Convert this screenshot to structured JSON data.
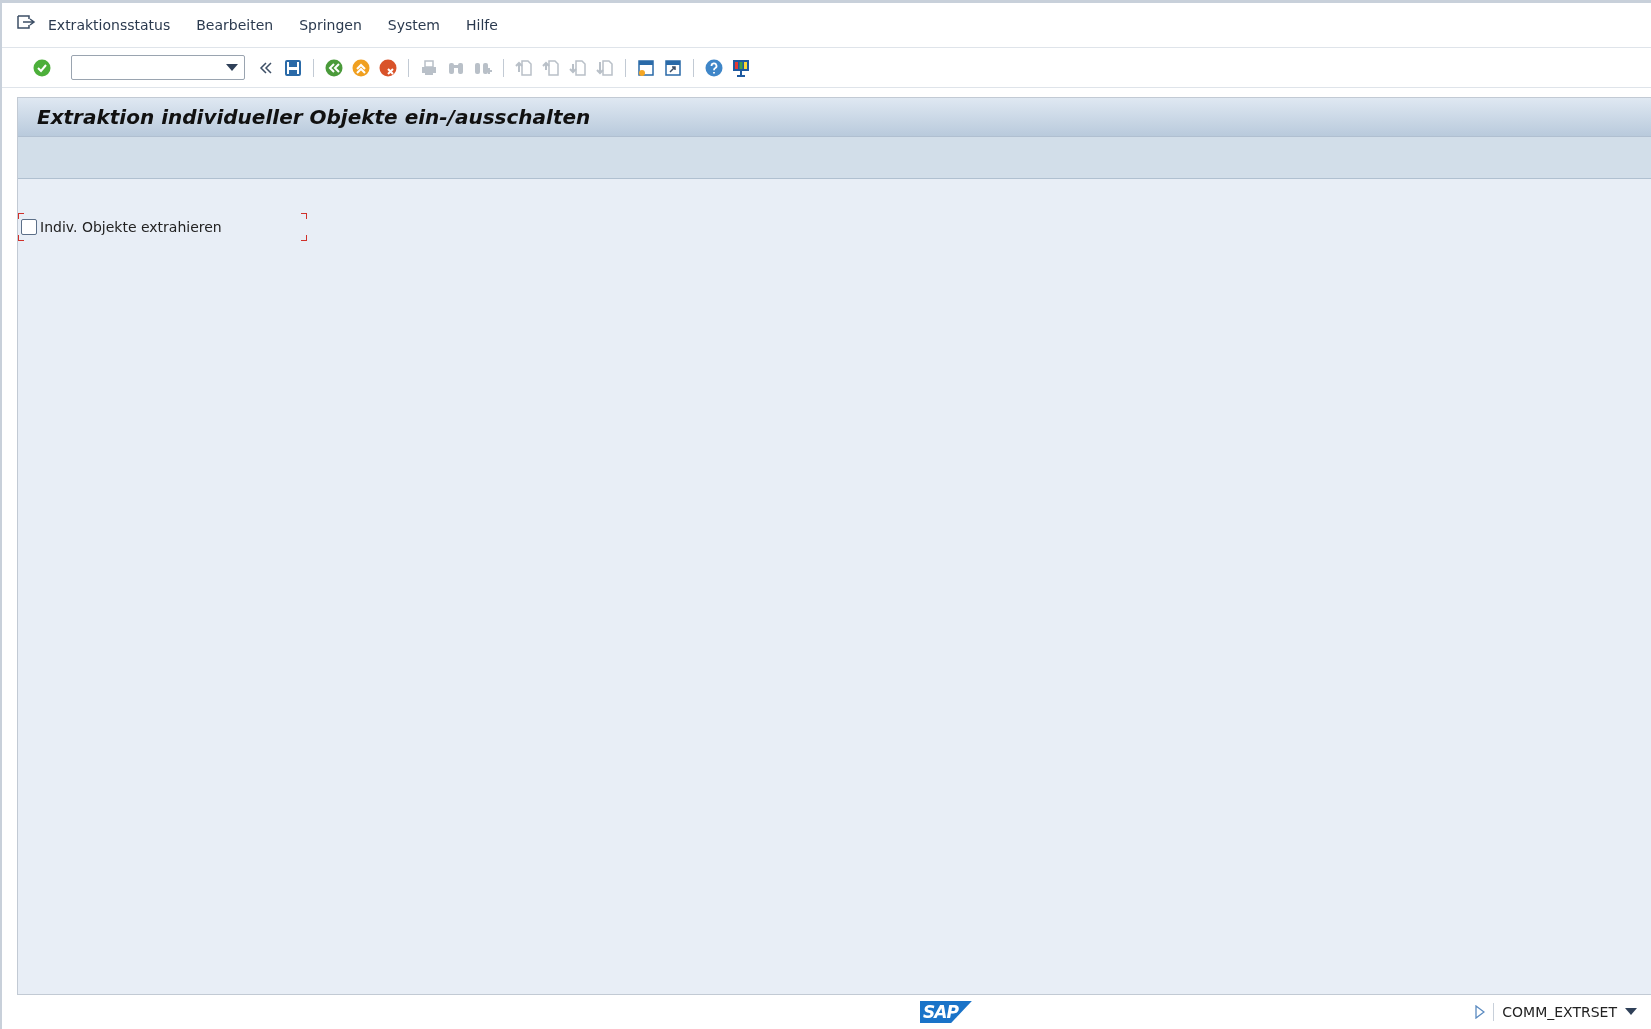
{
  "menu_bar": {
    "items": [
      {
        "label": "Extraktionsstatus"
      },
      {
        "label": "Bearbeiten"
      },
      {
        "label": "Springen"
      },
      {
        "label": "System"
      },
      {
        "label": "Hilfe"
      }
    ]
  },
  "toolbar": {
    "groups": [
      [
        {
          "kind": "enter",
          "disabled": false
        },
        {
          "kind": "command-field",
          "disabled": false
        },
        {
          "kind": "collapse",
          "disabled": false
        },
        {
          "kind": "save",
          "disabled": false
        }
      ],
      [
        {
          "kind": "back",
          "disabled": false
        },
        {
          "kind": "exit",
          "disabled": false
        },
        {
          "kind": "cancel",
          "disabled": false
        }
      ],
      [
        {
          "kind": "print",
          "disabled": true
        },
        {
          "kind": "find",
          "disabled": true
        },
        {
          "kind": "find-next",
          "disabled": true
        }
      ],
      [
        {
          "kind": "first-page",
          "disabled": true
        },
        {
          "kind": "previous-page",
          "disabled": true
        },
        {
          "kind": "next-page",
          "disabled": true
        },
        {
          "kind": "last-page",
          "disabled": true
        }
      ],
      [
        {
          "kind": "new-session",
          "disabled": false
        },
        {
          "kind": "shortcut",
          "disabled": false
        }
      ],
      [
        {
          "kind": "help",
          "disabled": false
        },
        {
          "kind": "layout",
          "disabled": false
        }
      ]
    ]
  },
  "screen": {
    "title": "Extraktion individueller Objekte ein-/ausschalten",
    "fields": [
      {
        "kind": "checkbox",
        "label": "Indiv. Objekte extrahieren",
        "checked": false
      }
    ]
  },
  "status_bar": {
    "logo_text": "SAP",
    "transaction": "COMM_EXTRSET"
  }
}
